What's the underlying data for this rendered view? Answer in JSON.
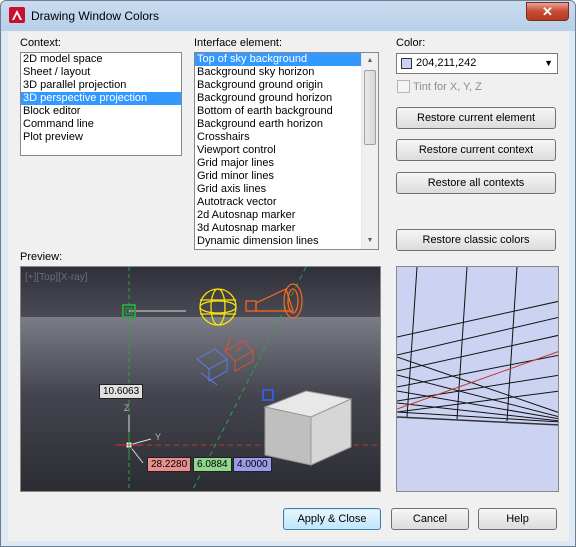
{
  "window": {
    "title": "Drawing Window Colors",
    "close_label": "✕"
  },
  "context": {
    "label": "Context:",
    "items": [
      "2D model space",
      "Sheet / layout",
      "3D parallel projection",
      "3D perspective projection",
      "Block editor",
      "Command line",
      "Plot preview"
    ],
    "selected_index": 3
  },
  "interface": {
    "label": "Interface element:",
    "items": [
      "Top of sky background",
      "Background sky horizon",
      "Background ground origin",
      "Background ground horizon",
      "Bottom of earth background",
      "Background earth horizon",
      "Crosshairs",
      "Viewport control",
      "Grid major lines",
      "Grid minor lines",
      "Grid axis lines",
      "Autotrack vector",
      "2d Autosnap marker",
      "3d Autosnap marker",
      "Dynamic dimension lines"
    ],
    "selected_index": 0
  },
  "color": {
    "label": "Color:",
    "value": "204,211,242",
    "swatch": "#ccd3f2",
    "tint_label": "Tint for X, Y, Z"
  },
  "buttons": {
    "restore_element": "Restore current element",
    "restore_context": "Restore current context",
    "restore_all": "Restore all contexts",
    "restore_classic": "Restore classic colors",
    "apply_close": "Apply & Close",
    "cancel": "Cancel",
    "help": "Help"
  },
  "preview": {
    "label": "Preview:",
    "viewport_label": "[+][Top][X-ray]",
    "dim_value": "10.6063",
    "coord_x": "28.2280",
    "coord_y": "6.0884",
    "coord_z": "4.0000",
    "axis_z": "Z",
    "axis_y": "Y"
  },
  "colors": {
    "accent": "#3399ff",
    "sky_top": "#ccd3f2",
    "earth": "#2b2c33"
  }
}
